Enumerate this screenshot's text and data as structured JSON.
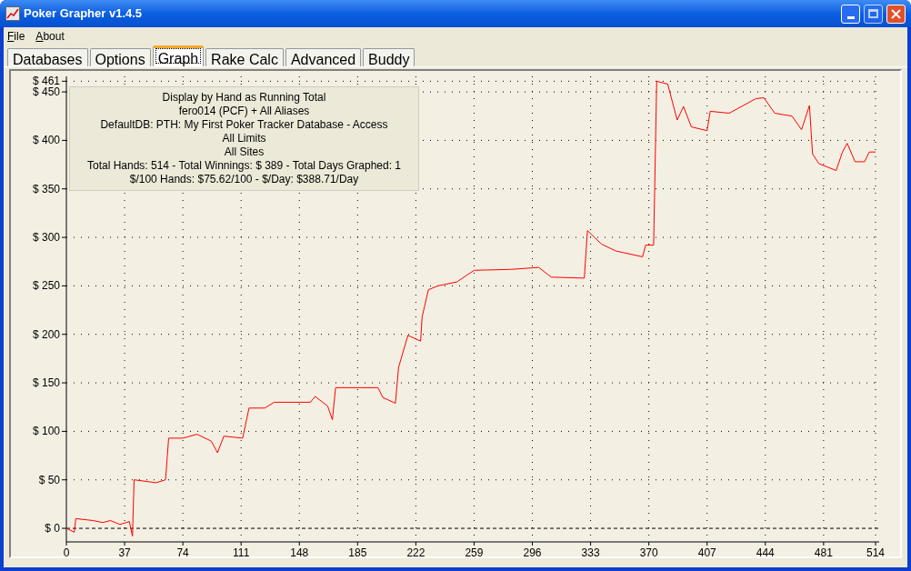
{
  "window": {
    "title": "Poker Grapher v1.4.5"
  },
  "menu": [
    {
      "label": "File"
    },
    {
      "label": "About"
    }
  ],
  "tabs": [
    {
      "label": "Databases",
      "selected": false
    },
    {
      "label": "Options",
      "selected": false
    },
    {
      "label": "Graph",
      "selected": true
    },
    {
      "label": "Rake Calc",
      "selected": false
    },
    {
      "label": "Advanced",
      "selected": false
    },
    {
      "label": "Buddy",
      "selected": false
    }
  ],
  "legend": [
    "Display by Hand as Running Total",
    "fero014 (PCF) + All Aliases",
    "DefaultDB: PTH: My First Poker Tracker Database - Access",
    "All Limits",
    "All Sites",
    "Total Hands: 514 - Total Winnings: $ 389 - Total Days Graphed: 1",
    "$/100 Hands: $75.62/100 - $/Day: $388.71/Day"
  ],
  "chart_data": {
    "type": "line",
    "grid": true,
    "xlim": [
      0,
      514
    ],
    "ylim": [
      -14,
      466
    ],
    "xticks": [
      0,
      37,
      74,
      111,
      148,
      185,
      222,
      259,
      296,
      333,
      370,
      407,
      444,
      481,
      514
    ],
    "yticks": [
      {
        "value": 0,
        "label": "$ 0"
      },
      {
        "value": 50,
        "label": "$ 50"
      },
      {
        "value": 100,
        "label": "$ 100"
      },
      {
        "value": 150,
        "label": "$ 150"
      },
      {
        "value": 200,
        "label": "$ 200"
      },
      {
        "value": 250,
        "label": "$ 250"
      },
      {
        "value": 300,
        "label": "$ 300"
      },
      {
        "value": 350,
        "label": "$ 350"
      },
      {
        "value": 400,
        "label": "$ 400"
      },
      {
        "value": 450,
        "label": "$ 450"
      },
      {
        "value": 461,
        "label": "$ 461"
      }
    ],
    "x": [
      0,
      5,
      6,
      17,
      23,
      28,
      34,
      40,
      42,
      43,
      57,
      63,
      65,
      74,
      83,
      92,
      96,
      100,
      112,
      116,
      126,
      132,
      155,
      158,
      166,
      169,
      171,
      187,
      198,
      201,
      209,
      211,
      217,
      225,
      226,
      230,
      236,
      248,
      259,
      282,
      300,
      308,
      329,
      331,
      340,
      349,
      366,
      368,
      373,
      375,
      382,
      388,
      392,
      397,
      407,
      409,
      421,
      438,
      443,
      450,
      461,
      467,
      472,
      474,
      478,
      489,
      493,
      496,
      501,
      507,
      510,
      514
    ],
    "series": [
      {
        "color": "#ff0000",
        "values": [
          0,
          -4,
          10,
          8,
          6,
          8,
          4,
          7,
          -8,
          50,
          47,
          50,
          93,
          93,
          97,
          90,
          78,
          95,
          93,
          124,
          124,
          130,
          130,
          136,
          126,
          112,
          145,
          145,
          145,
          135,
          129,
          166,
          199,
          193,
          218,
          246,
          250,
          254,
          266,
          267,
          269,
          259,
          258,
          307,
          293,
          286,
          280,
          292,
          292,
          461,
          458,
          421,
          435,
          414,
          410,
          430,
          428,
          443,
          444,
          428,
          425,
          411,
          436,
          386,
          376,
          369,
          388,
          397,
          378,
          378,
          388,
          388
        ]
      }
    ]
  }
}
